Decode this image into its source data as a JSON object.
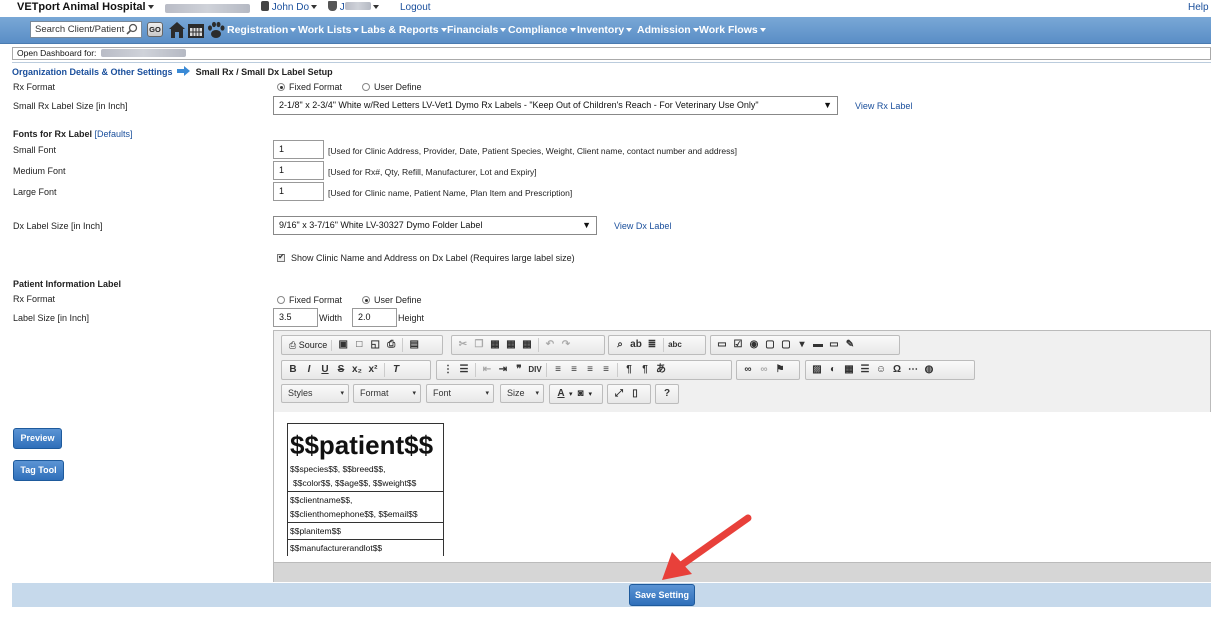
{
  "top": {
    "app_name": "VETport Animal Hospital",
    "user1": "John Do",
    "user2": "J",
    "logout": "Logout",
    "help": "Help"
  },
  "nav": {
    "search_placeholder": "Search Client/Patient",
    "go": "GO",
    "menus": [
      "Registration",
      "Work Lists",
      "Labs & Reports",
      "Financials",
      "Compliance",
      "Inventory",
      "Admission",
      "Work Flows"
    ]
  },
  "dashboard_label": "Open Dashboard for:",
  "breadcrumb": {
    "parent": "Organization Details & Other Settings",
    "current": "Small Rx / Small Dx Label Setup"
  },
  "rx_format": {
    "label": "Rx Format",
    "opt_fixed": "Fixed Format",
    "opt_user": "User Define",
    "selected": "Fixed Format"
  },
  "small_rx_size": {
    "label": "Small Rx Label Size [in Inch]",
    "value": "2-1/8\" x 2-3/4\" White w/Red Letters LV-Vet1 Dymo Rx Labels - \"Keep Out of Children's Reach - For Veterinary Use Only\"",
    "view_link": "View Rx Label"
  },
  "fonts": {
    "heading": "Fonts for Rx Label",
    "defaults_link": "[Defaults]",
    "small": {
      "label": "Small Font",
      "value": "1",
      "hint": "[Used for Clinic Address, Provider, Date, Patient Species, Weight, Client name, contact number and address]"
    },
    "medium": {
      "label": "Medium Font",
      "value": "1",
      "hint": "[Used for Rx#, Qty, Refill, Manufacturer, Lot and Expiry]"
    },
    "large": {
      "label": "Large Font",
      "value": "1",
      "hint": "[Used for Clinic name, Patient Name, Plan Item and Prescription]"
    }
  },
  "dx_size": {
    "label": "Dx Label Size [in Inch]",
    "value": "9/16\" x 3-7/16\" White LV-30327 Dymo Folder Label",
    "view_link": "View Dx Label"
  },
  "show_clinic": {
    "label": "Show Clinic Name and Address on Dx Label (Requires large label size)",
    "checked": true
  },
  "patient_info": {
    "heading": "Patient Information Label",
    "rx_format_label": "Rx Format",
    "opt_fixed": "Fixed Format",
    "opt_user": "User Define",
    "selected": "User Define",
    "size_label": "Label Size [in Inch]",
    "width": "3.5",
    "width_label": "Width",
    "height": "2.0",
    "height_label": "Height"
  },
  "editor": {
    "source": "Source",
    "styles": "Styles",
    "format": "Format",
    "font": "Font",
    "size": "Size",
    "content": {
      "title": "$$patient$$",
      "species_line1": "$$species$$, $$breed$$,",
      "species_line2": "$$color$$, $$age$$, $$weight$$",
      "client_line1": "$$clientname$$,",
      "client_line2": "$$clienthomephone$$, $$email$$",
      "planitem": "$$planitem$$",
      "manufacturer": "$$manufacturerandlot$$"
    }
  },
  "buttons": {
    "preview": "Preview",
    "tag_tool": "Tag Tool",
    "save": "Save Setting"
  },
  "colors": {
    "nav_bg": "#5a8ec6",
    "link": "#1a4f9c",
    "button": "#2f6fba",
    "annotation_arrow": "#e8403a"
  }
}
